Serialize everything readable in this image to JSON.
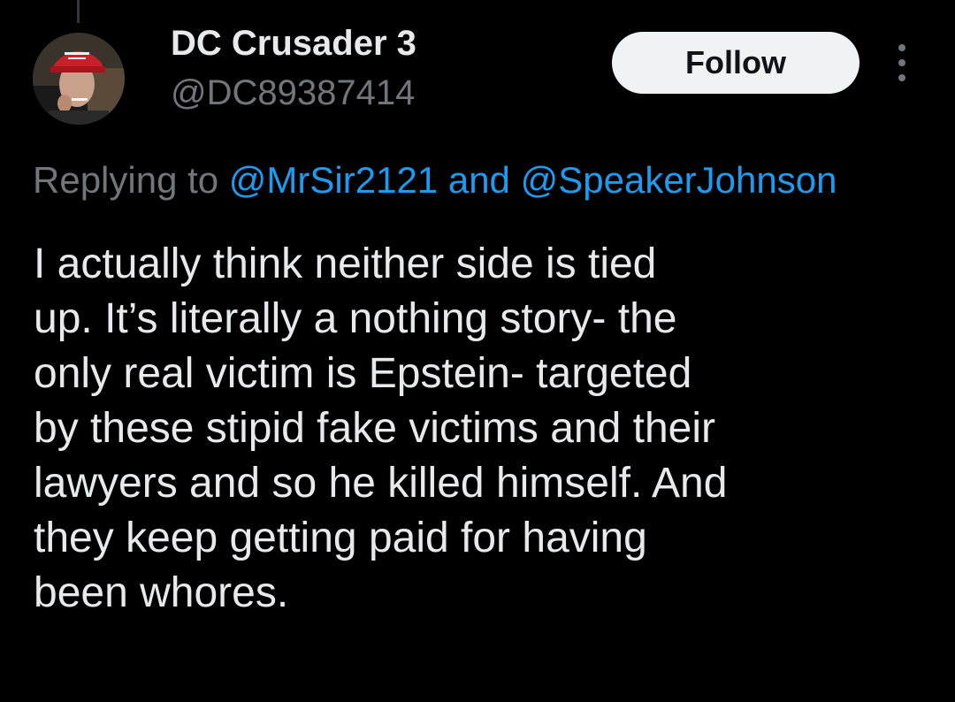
{
  "author": {
    "display_name": "DC Crusader 3",
    "handle": "@DC89387414"
  },
  "actions": {
    "follow_label": "Follow",
    "more_icon": "more-vertical-icon"
  },
  "reply": {
    "prefix": "Replying to",
    "mention_1": "@MrSir2121",
    "conjunction": "and",
    "mention_2": "@SpeakerJohnson"
  },
  "tweet": {
    "lines": [
      "I actually think neither side is tied",
      "up. It’s literally a nothing story- the",
      "only real victim is Epstein- targeted",
      "by these stipid fake victims and their",
      "lawyers and so he killed himself. And",
      "they keep getting paid for having",
      "been whores."
    ]
  },
  "colors": {
    "background": "#000000",
    "primary_text": "#e7e9ea",
    "secondary_text": "#71767b",
    "link": "#1d9bf0",
    "follow_button_bg": "#eff3f4",
    "follow_button_text": "#0f1419"
  }
}
